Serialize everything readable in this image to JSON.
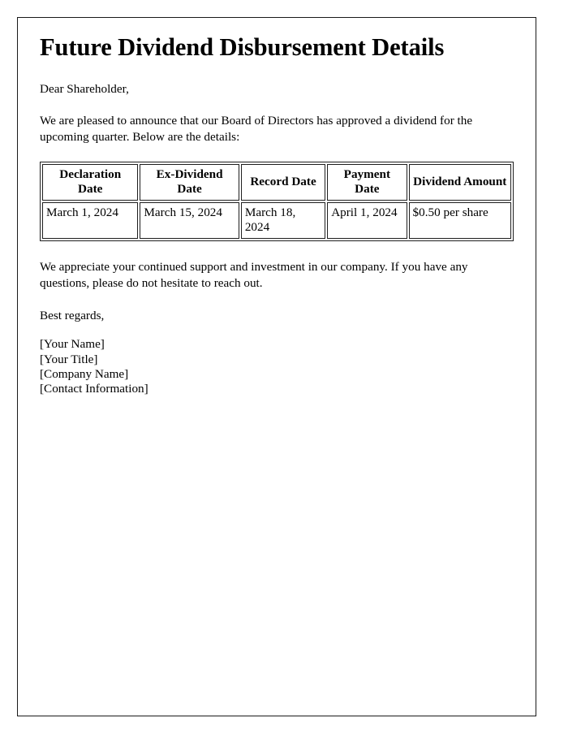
{
  "document": {
    "title": "Future Dividend Disbursement Details",
    "salutation": "Dear Shareholder,",
    "intro_paragraph": "We are pleased to announce that our Board of Directors has approved a dividend for the upcoming quarter. Below are the details:",
    "closing_paragraph": "We appreciate your continued support and investment in our company. If you have any questions, please do not hesitate to reach out.",
    "regards": "Best regards,",
    "signature": {
      "name": "[Your Name]",
      "title": "[Your Title]",
      "company": "[Company Name]",
      "contact": "[Contact Information]"
    }
  },
  "table": {
    "headers": [
      "Declaration Date",
      "Ex-Dividend Date",
      "Record Date",
      "Payment Date",
      "Dividend Amount"
    ],
    "rows": [
      {
        "declaration_date": "March 1, 2024",
        "ex_dividend_date": "March 15, 2024",
        "record_date": "March 18, 2024",
        "payment_date": "April 1, 2024",
        "dividend_amount": "$0.50 per share"
      }
    ]
  },
  "colors": {
    "text": "#000000",
    "page_background": "#ffffff",
    "border": "#1f1f1f",
    "frame_border": "#1a1a1a"
  }
}
